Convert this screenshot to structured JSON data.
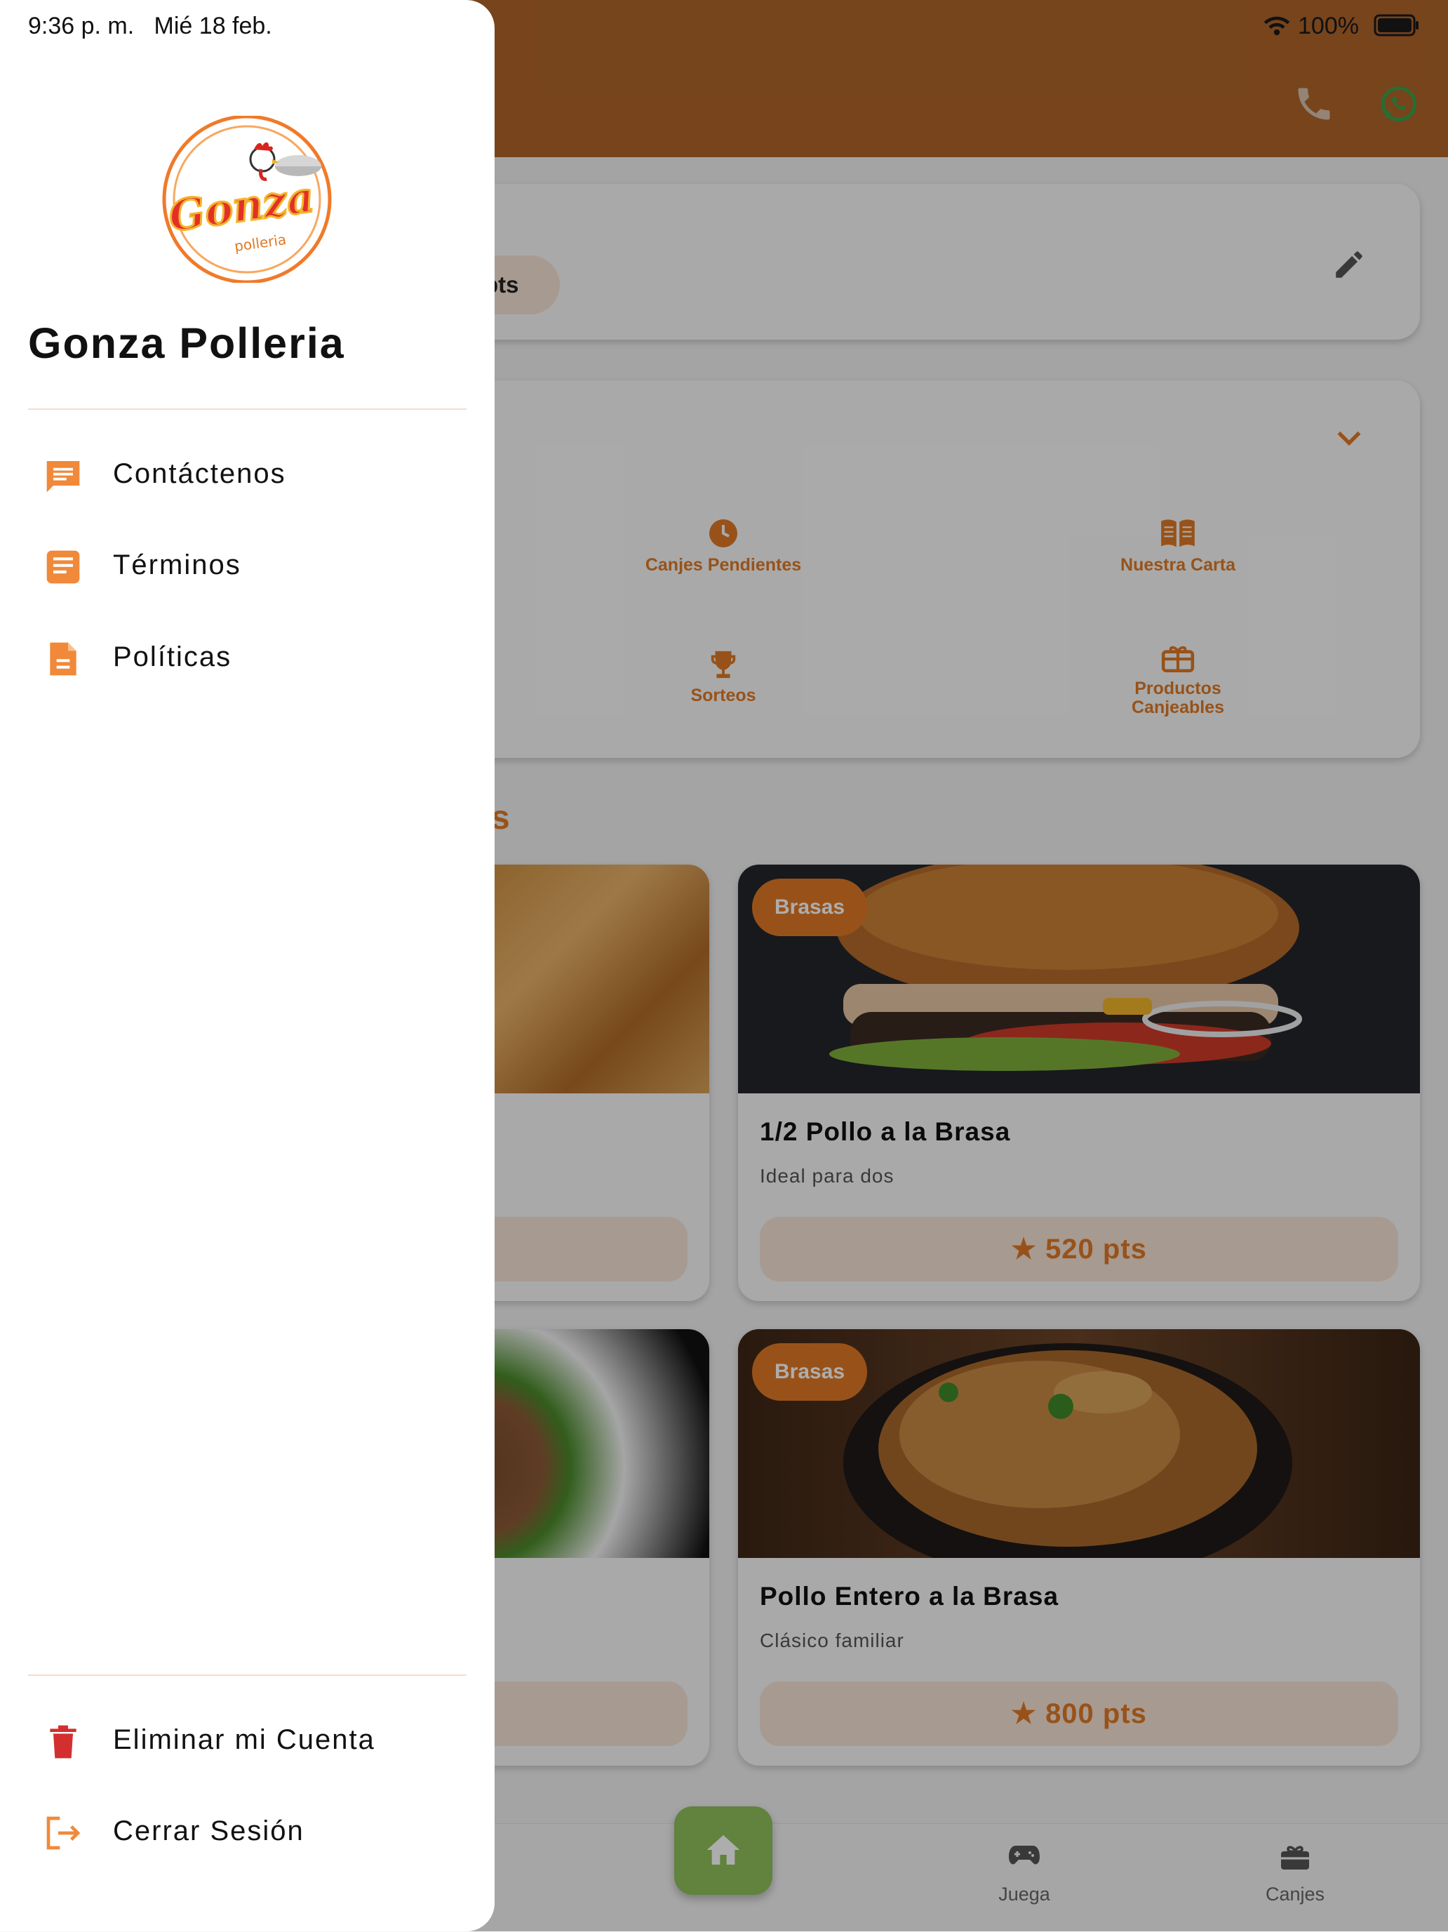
{
  "status_bar": {
    "time": "9:36 p. m.",
    "date": "Mié 18 feb.",
    "battery": "100%"
  },
  "colors": {
    "accent": "#e07a25",
    "header": "#b0652a",
    "danger": "#d32f2f",
    "fab": "#8fc25a",
    "whatsapp": "#3aa34a"
  },
  "drawer": {
    "logo": {
      "script": "Gonza",
      "sub": "polleria"
    },
    "brand_name": "Gonza Polleria",
    "menu": [
      {
        "label": "Contáctenos",
        "icon": "chat-icon"
      },
      {
        "label": "Términos",
        "icon": "document-icon"
      },
      {
        "label": "Políticas",
        "icon": "file-icon"
      }
    ],
    "footer": [
      {
        "label": "Eliminar mi Cuenta",
        "icon": "trash-icon"
      },
      {
        "label": "Cerrar Sesión",
        "icon": "logout-icon"
      }
    ]
  },
  "points_card": {
    "pill_suffix": "pts"
  },
  "quick_access": [
    {
      "label": "Canjes Pendientes",
      "icon": "clock-icon"
    },
    {
      "label": "Nuestra Carta",
      "icon": "menu-book-icon"
    },
    {
      "label": "Sorteos",
      "icon": "trophy-icon"
    },
    {
      "label": "Productos Canjeables",
      "icon": "gift-icon"
    }
  ],
  "section_title_fragment": "s",
  "products": [
    {
      "badge": "Brasas",
      "title": "1/2 Pollo a la Brasa",
      "subtitle": "Ideal para dos",
      "points": "520 pts"
    },
    {
      "badge": "Brasas",
      "title": "Pollo Entero a la Brasa",
      "subtitle": "Clásico familiar",
      "points": "800 pts"
    }
  ],
  "bottom_nav": [
    {
      "label": "Juega",
      "icon": "gamepad-icon"
    },
    {
      "label": "Canjes",
      "icon": "gift-icon"
    }
  ]
}
